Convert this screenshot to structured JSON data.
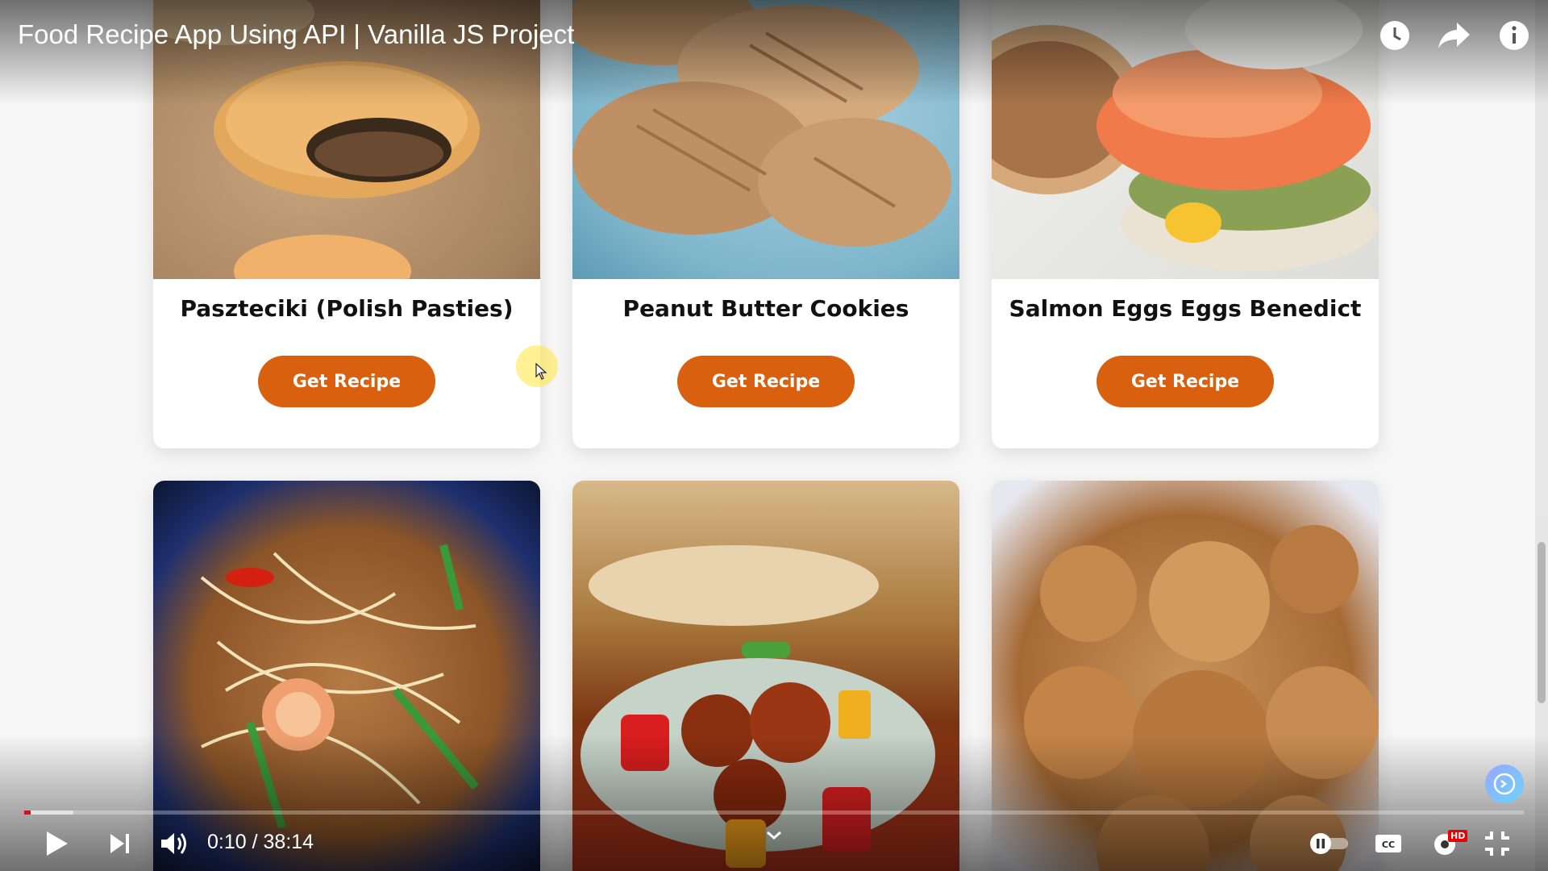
{
  "video": {
    "title": "Food Recipe App Using API | Vanilla JS Project",
    "current_time": "0:10",
    "duration": "38:14",
    "time_separator": " / ",
    "progress_fraction": 0.0044,
    "buffered_fraction": 0.033
  },
  "top_icons": [
    "watch-later-icon",
    "share-icon",
    "info-icon"
  ],
  "controls": {
    "left": [
      "play-icon",
      "next-icon",
      "volume-icon"
    ],
    "right": [
      "autoplay-toggle",
      "captions-icon",
      "settings-icon",
      "exit-fullscreen-icon"
    ],
    "hd_badge": "HD"
  },
  "recipes_row1": [
    {
      "name": "Paszteciki (Polish Pasties)",
      "button": "Get Recipe"
    },
    {
      "name": "Peanut Butter Cookies",
      "button": "Get Recipe"
    },
    {
      "name": "Salmon Eggs Eggs Benedict",
      "button": "Get Recipe"
    }
  ],
  "colors": {
    "accent": "#d9600f",
    "progress": "#ff0000"
  }
}
